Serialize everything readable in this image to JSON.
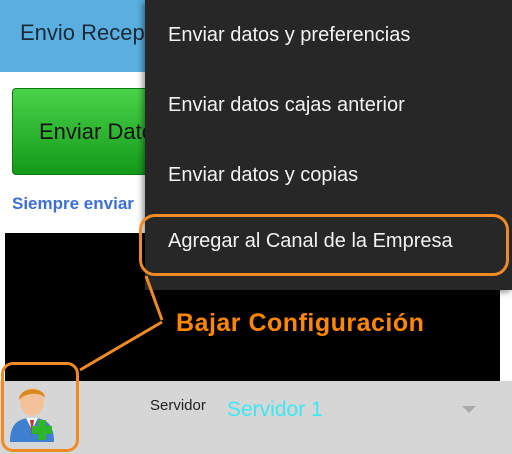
{
  "app_bar": {
    "title": "Envio Recepción"
  },
  "main": {
    "send_button_label": "Enviar Datos",
    "always_send_text": "Siempre enviar"
  },
  "bottom_bar": {
    "server_label": "Servidor",
    "server_value": "Servidor 1",
    "avatar_icon": "user-add-icon"
  },
  "menu": {
    "items": [
      {
        "label": "Enviar datos y preferencias"
      },
      {
        "label": "Enviar datos cajas anterior"
      },
      {
        "label": "Enviar datos y copias"
      },
      {
        "label": "Agregar al Canal de la Empresa"
      }
    ]
  },
  "annotation": {
    "callout_text": "Bajar Configuración",
    "highlight_color": "#f08a24",
    "callout_color": "#ff8800"
  },
  "colors": {
    "app_bar": "#5aaee0",
    "send_button": "#2bb52e",
    "menu_background": "#272727",
    "server_value": "#3ce8f2"
  }
}
